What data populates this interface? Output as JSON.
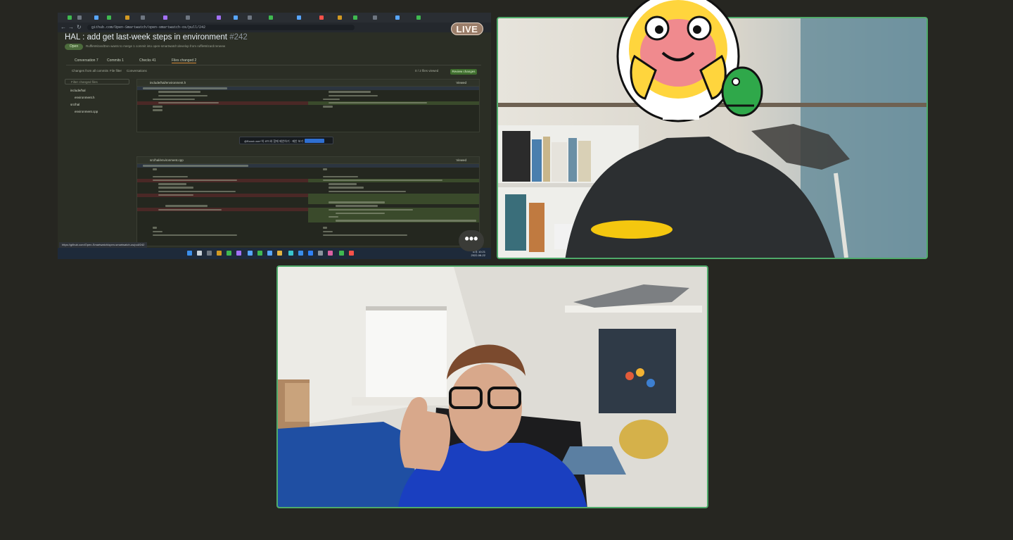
{
  "screen_share": {
    "url_text": "github.com/Open-Smartwatch/open-smartwatch-os/pull/242",
    "pr_title": "HAL : add get last-week steps in environment",
    "pr_number": "#242",
    "pr_state": "Open",
    "pr_subtitle": "RuffleWizardDon wants to merge 1 commit into  open-smartwatch:develop  from  ruffleWizard:reneew",
    "tabs": {
      "conversation": "Conversation",
      "conversation_count": "7",
      "commits": "Commits",
      "commits_count": "1",
      "checks": "Checks",
      "checks_count": "41",
      "files_changed": "Files changed",
      "files_count": "2"
    },
    "toolbar": {
      "changes_from": "Changes from all commits",
      "file_filter": "File filter",
      "conversations": "Conversations",
      "files_viewed": "0 / 2 files viewed",
      "review_button": "Review changes"
    },
    "file_tree": {
      "filter_placeholder": "Filter changed files",
      "folder1": "include/hal",
      "file1": "environment.h",
      "folder2": "src/hal",
      "file2": "environment.cpp"
    },
    "diff1": {
      "header": "include/hal/environment.h",
      "viewed_label": "Viewed"
    },
    "diff2": {
      "header": "src/hal/environment.cpp",
      "viewed_label": "Viewed"
    },
    "tooltip_text": "@Boost.user“의 코드와 함께 제안하기 ·  제안 보기",
    "status_url": "https://github.com/Open-Smartwatch/open-smartwatch-os/pull/242",
    "tray_time": "오후 10:21",
    "tray_date": "2022-08-22"
  },
  "live_badge": "LIVE",
  "more_button_label": "•••",
  "colors": {
    "background": "#262621",
    "active_speaker_border": "#4faa6a",
    "live_badge": "#9b7e6a"
  },
  "icons": [
    "more-icon",
    "sticker-face-icon",
    "censor-blob-icon"
  ]
}
